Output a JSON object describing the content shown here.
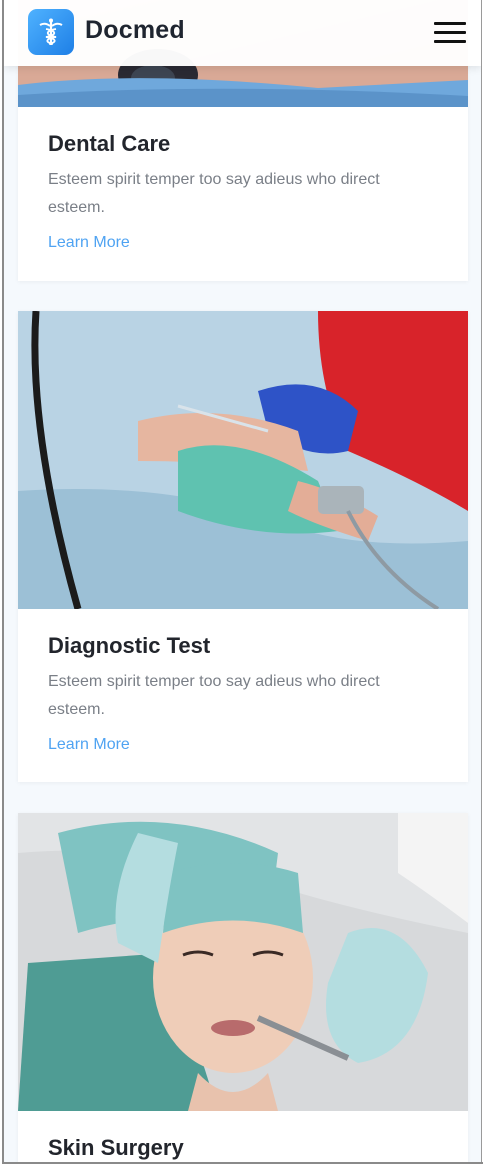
{
  "header": {
    "brand": "Docmed",
    "logo_icon": "caduceus-icon",
    "menu_icon": "hamburger-menu-icon"
  },
  "colors": {
    "accent": "#4fa3f2",
    "logo_gradient_start": "#4fb2ff",
    "logo_gradient_end": "#1e7fe6",
    "page_background": "#f5f9fd"
  },
  "services": [
    {
      "title": "Dental Care",
      "description": "Esteem spirit temper too say adieus who direct esteem.",
      "link": "Learn More",
      "image": "dental-procedure-photo"
    },
    {
      "title": "Diagnostic Test",
      "description": "Esteem spirit temper too say adieus who direct esteem.",
      "link": "Learn More",
      "image": "iv-drip-diagnostic-photo"
    },
    {
      "title": "Skin Surgery",
      "description": "",
      "link": "",
      "image": "facial-skin-treatment-photo"
    }
  ]
}
